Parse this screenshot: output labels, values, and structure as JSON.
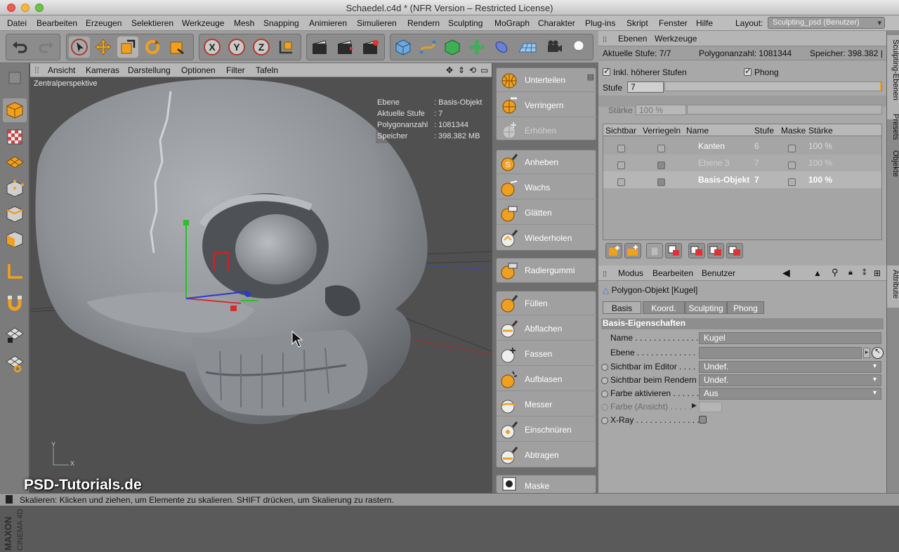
{
  "window": {
    "title": "Schaedel.c4d * (NFR Version – Restricted License)"
  },
  "menubar": {
    "items": [
      "Datei",
      "Bearbeiten",
      "Erzeugen",
      "Selektieren",
      "Werkzeuge",
      "Mesh",
      "Snapping",
      "Animieren",
      "Simulieren",
      "Rendern",
      "Sculpting",
      "MoGraph",
      "Charakter",
      "Plug-ins",
      "Skript",
      "Fenster",
      "Hilfe"
    ],
    "layout_label": "Layout:",
    "layout_value": "Sculpting_psd (Benutzer)"
  },
  "viewport_menu": {
    "items": [
      "Ansicht",
      "Kameras",
      "Darstellung",
      "Optionen",
      "Filter",
      "Tafeln"
    ]
  },
  "viewport": {
    "label": "Zentralperspektive",
    "hud": [
      {
        "key": "Ebene",
        "value": ": Basis-Objekt"
      },
      {
        "key": "Aktuelle Stufe",
        "value": ": 7"
      },
      {
        "key": "Polygonanzahl",
        "value": ": 1081344"
      },
      {
        "key": "Speicher",
        "value": ": 398.382 MB"
      }
    ],
    "axis_y": "Y",
    "axis_x": "X",
    "watermark": "PSD-Tutorials.de"
  },
  "brushes": {
    "group1": [
      "Unterteilen",
      "Verringern",
      "Erhöhen"
    ],
    "group2": [
      "Anheben",
      "Wachs",
      "Glätten",
      "Wiederholen"
    ],
    "group3": [
      "Radiergummi"
    ],
    "group4": [
      "Füllen",
      "Abflachen",
      "Fassen",
      "Aufblasen",
      "Messer",
      "Einschnüren",
      "Abtragen"
    ],
    "group5": [
      "Maske"
    ]
  },
  "layers_panel": {
    "tabs": [
      "Ebenen",
      "Werkzeuge"
    ],
    "current_level_label": "Aktuelle Stufe: 7/7",
    "polygon_count_label": "Polygonanzahl: 1081344",
    "memory_label": "Speicher: 398.382 |",
    "incl_higher_levels": "Inkl. höherer Stufen",
    "phong": "Phong",
    "stufe_label": "Stufe",
    "stufe_value": "7",
    "staerke_label": "Stärke",
    "staerke_value": "100 %",
    "columns": [
      "Sichtbar",
      "Verriegeln",
      "Name",
      "Stufe",
      "Maske",
      "Stärke"
    ],
    "rows": [
      {
        "name": "Kanten",
        "stufe": "6",
        "staerke": "100 %"
      },
      {
        "name": "Ebene 3",
        "stufe": "7",
        "staerke": "100 %"
      },
      {
        "name": "Basis-Objekt",
        "stufe": "7",
        "staerke": "100 %"
      }
    ]
  },
  "attributes_panel": {
    "menu": [
      "Modus",
      "Bearbeiten",
      "Benutzer"
    ],
    "object_title": "Polygon-Objekt [Kugel]",
    "tabs": [
      "Basis",
      "Koord.",
      "Sculpting",
      "Phong"
    ],
    "section": "Basis-Eigenschaften",
    "props": [
      {
        "label": "Name . . . . . . . . . . . . . . .",
        "value": "Kugel"
      },
      {
        "label": "Ebene . . . . . . . . . . . . . . .",
        "value": ""
      },
      {
        "label": "Sichtbar im Editor . . . . .",
        "value": "Undef."
      },
      {
        "label": "Sichtbar beim Rendern",
        "value": "Undef."
      },
      {
        "label": "Farbe aktivieren . . . . . .",
        "value": "Aus"
      },
      {
        "label": "Farbe (Ansicht) . . . . .",
        "value": ""
      },
      {
        "label": "X-Ray . . . . . . . . . . . . . . .",
        "value": ""
      }
    ]
  },
  "side_tabs": [
    "Sculpting-Ebenen",
    "Presets",
    "Objekte",
    "Attribute"
  ],
  "statusbar": {
    "text": "Skalieren: Klicken und ziehen, um Elemente zu skalieren. SHIFT drücken, um Skalierung zu rastern."
  },
  "colors": {
    "accent": "#f0a020",
    "viewport_bg": "#4f4f4f",
    "panel_bg": "#a8a8a8"
  }
}
